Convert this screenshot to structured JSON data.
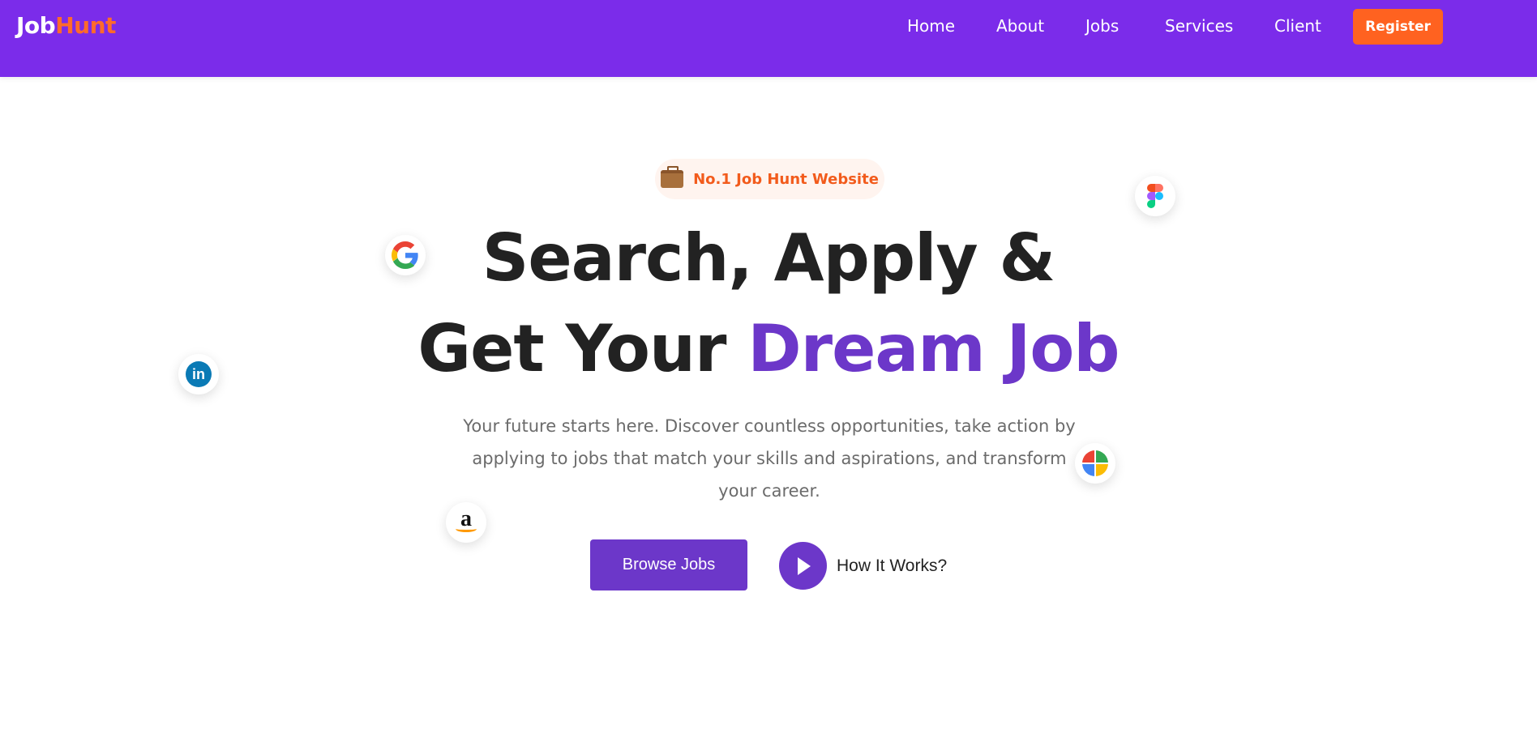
{
  "brand": {
    "logo_part1": "Job",
    "logo_part2": "Hunt"
  },
  "nav": {
    "items": [
      {
        "label": "Home"
      },
      {
        "label": "About"
      },
      {
        "label": "Jobs"
      },
      {
        "label": "Services"
      },
      {
        "label": "Client"
      }
    ],
    "register_label": "Register"
  },
  "hero": {
    "badge_text": "No.1 Job Hunt Website",
    "headline_line1": "Search, Apply &",
    "headline_line2_plain": "Get Your",
    "headline_line2_accent": "Dream Job",
    "subtitle": "Your future starts here. Discover countless opportunities, take action by applying to jobs that match your skills and aspirations, and transform your career.",
    "browse_label": "Browse Jobs",
    "how_label": "How It Works?"
  },
  "floating_icons": [
    "google-icon",
    "linkedin-icon",
    "figma-icon",
    "windows-icon",
    "amazon-icon"
  ],
  "colors": {
    "nav_bg": "#7b2cea",
    "brand_orange": "#ff6220",
    "accent_purple": "#6c37c9",
    "headline": "#222222",
    "subtitle": "#6b6b6b"
  }
}
